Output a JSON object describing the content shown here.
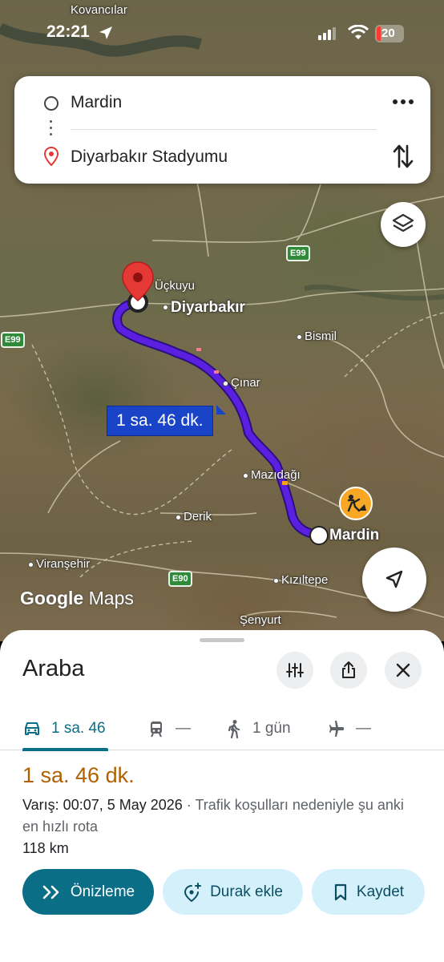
{
  "status_bar": {
    "time": "22:21",
    "battery": "20"
  },
  "route_search": {
    "origin": "Mardin",
    "destination": "Diyarbakır Stadyumu"
  },
  "map": {
    "cities": {
      "kovancilar": "Kovancılar",
      "ucKuyu": "Üçkuyu",
      "diyarbakir": "Diyarbakır",
      "bismil": "Bismil",
      "cinar": "Çınar",
      "mazidagi": "Mazıdağı",
      "derik": "Derik",
      "mardin": "Mardin",
      "viransehir": "Viranşehir",
      "kiziltepe": "Kızıltepe",
      "senyurt": "Şenyurt"
    },
    "road_shields": {
      "e99_top": "E99",
      "e99_left": "E99",
      "e90": "E90"
    },
    "route_duration_label": "1 sa. 46 dk.",
    "logo": {
      "google": "Google",
      "maps": "Maps"
    }
  },
  "sheet": {
    "title": "Araba",
    "modes": {
      "car": "1 sa. 46",
      "transit": "—",
      "walk": "1 gün",
      "flight": "—"
    },
    "duration": "1 sa. 46 dk.",
    "arrival_strong": "Varış: 00:07, 5 May 2026",
    "arrival_note": " · Trafik koşulları nedeniyle şu anki en hızlı rota",
    "distance": "118 km",
    "actions": {
      "preview": "Önizleme",
      "add_stop": "Durak ekle",
      "save": "Kaydet"
    }
  },
  "colors": {
    "route": "#5b1fe0",
    "accent": "#0b6e87",
    "duration": "#b06000"
  }
}
